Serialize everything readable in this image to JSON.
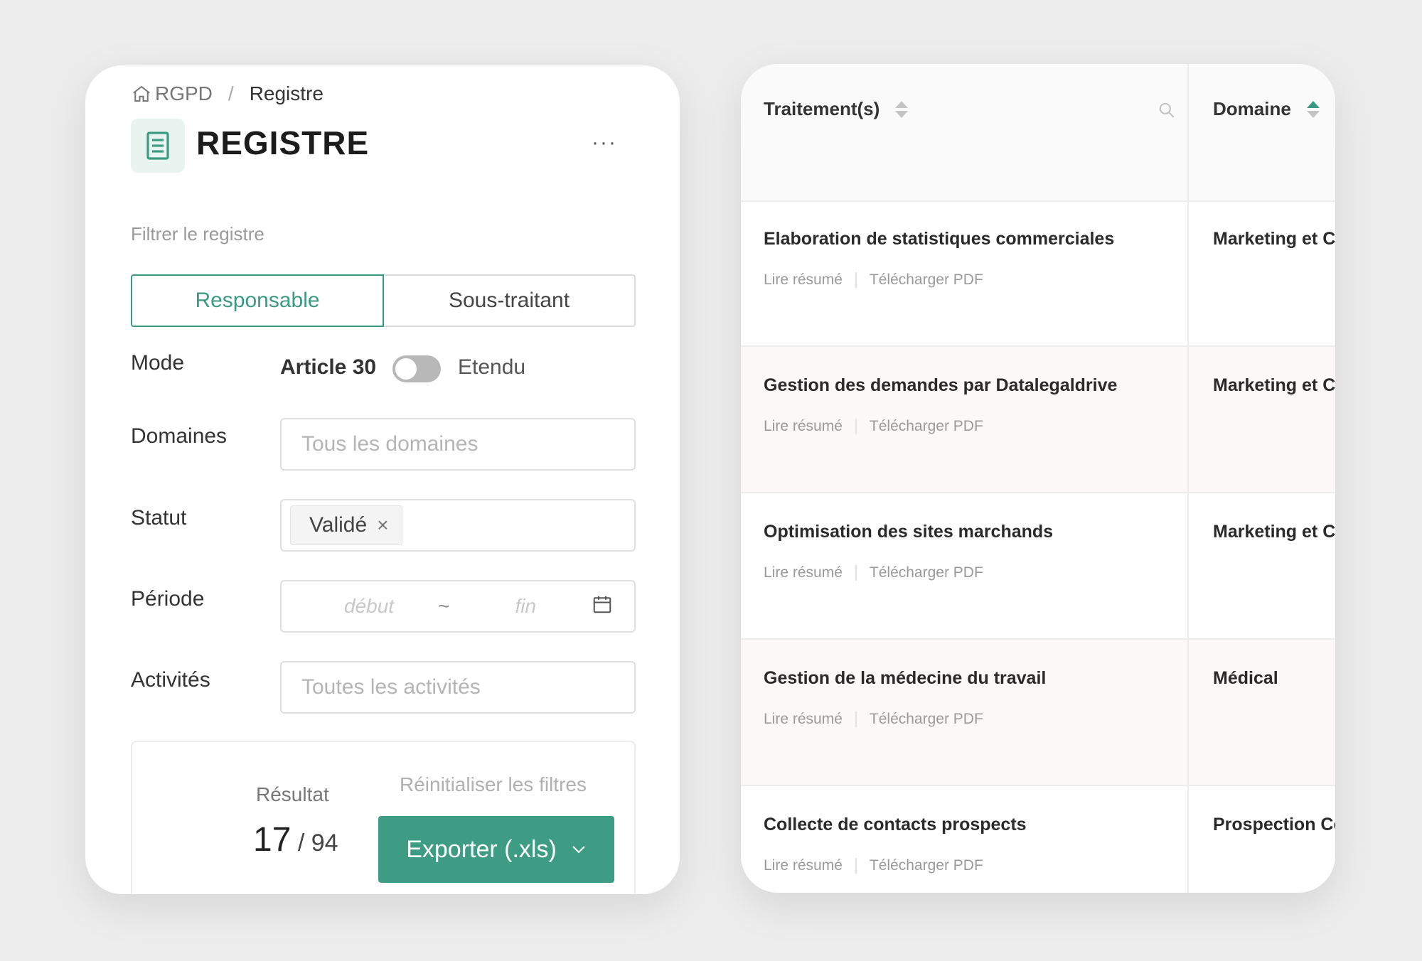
{
  "breadcrumb": {
    "root": "RGPD",
    "separator": "/",
    "current": "Registre"
  },
  "page": {
    "title": "REGISTRE",
    "more": "···"
  },
  "filters": {
    "label": "Filtrer le registre",
    "segment": {
      "active": "Responsable",
      "inactive": "Sous-traitant"
    },
    "mode": {
      "label": "Mode",
      "left": "Article 30",
      "right": "Etendu",
      "toggle_on": false
    },
    "domaines": {
      "label": "Domaines",
      "placeholder": "Tous les domaines"
    },
    "statut": {
      "label": "Statut",
      "tag": "Validé",
      "tag_remove": "×"
    },
    "periode": {
      "label": "Période",
      "start_placeholder": "début",
      "separator": "~",
      "end_placeholder": "fin"
    },
    "activites": {
      "label": "Activités",
      "placeholder": "Toutes les activités"
    }
  },
  "result": {
    "label": "Résultat",
    "count": "17",
    "total": " / 94",
    "reset": "Réinitialiser les filtres",
    "export": "Exporter (.xls)"
  },
  "table": {
    "col_traitement": "Traitement(s)",
    "col_domaine": "Domaine",
    "link_read": "Lire résumé",
    "link_pdf": "Télécharger PDF",
    "rows": [
      {
        "title": "Elaboration de statistiques commerciales",
        "domain": "Marketing et Co"
      },
      {
        "title": "Gestion des demandes par Datalegaldrive",
        "domain": "Marketing et Co"
      },
      {
        "title": "Optimisation des sites marchands",
        "domain": "Marketing et Co"
      },
      {
        "title": "Gestion de la médecine du travail",
        "domain": "Médical"
      },
      {
        "title": "Collecte de contacts prospects",
        "domain": "Prospection Co"
      }
    ]
  },
  "colors": {
    "accent": "#3d9c83",
    "accent_light": "#e9f3f0",
    "row_alt": "#fcf8f8"
  },
  "icons": [
    "home-icon",
    "document-icon",
    "calendar-icon",
    "search-icon",
    "chevron-down-icon",
    "sort-icon"
  ]
}
